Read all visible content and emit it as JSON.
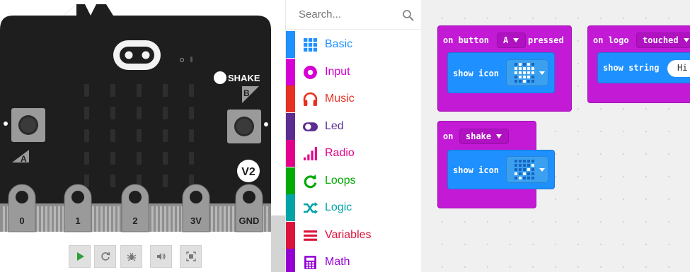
{
  "colors": {
    "board": "#1e1e1e",
    "pad": "#9a9a9a",
    "led_off": "#2e2e2e",
    "toolbox_border": "#e6e6e6",
    "event_block": "#c31ad6",
    "basic_block": "#1e90ff",
    "workspace": "#f0f0f0"
  },
  "simulator": {
    "shake_label": "SHAKE",
    "button_a": "A",
    "button_b": "B",
    "version_badge": "V2",
    "pins": [
      "0",
      "1",
      "2",
      "3V",
      "GND"
    ],
    "controls": [
      {
        "name": "play-icon"
      },
      {
        "name": "restart-icon"
      },
      {
        "name": "debug-icon"
      },
      {
        "name": "mute-icon"
      },
      {
        "name": "fullscreen-icon"
      }
    ]
  },
  "toolbox": {
    "search_placeholder": "Search...",
    "categories": [
      {
        "label": "Basic",
        "color": "#1e90ff",
        "icon": "grid-icon"
      },
      {
        "label": "Input",
        "color": "#d400d4",
        "icon": "target-icon"
      },
      {
        "label": "Music",
        "color": "#e63022",
        "icon": "headphones-icon"
      },
      {
        "label": "Led",
        "color": "#5c2d91",
        "icon": "toggle-icon"
      },
      {
        "label": "Radio",
        "color": "#e3008c",
        "icon": "signal-bars-icon"
      },
      {
        "label": "Loops",
        "color": "#00aa00",
        "icon": "loop-arrow-icon"
      },
      {
        "label": "Logic",
        "color": "#00a4a6",
        "icon": "shuffle-icon"
      },
      {
        "label": "Variables",
        "color": "#dc143c",
        "icon": "list-icon"
      },
      {
        "label": "Math",
        "color": "#9400d3",
        "icon": "calculator-icon"
      }
    ]
  },
  "workspace": {
    "block_button": {
      "prefix": "on button",
      "value": "A",
      "suffix": "pressed",
      "inner": "show icon"
    },
    "block_logo": {
      "prefix": "on logo",
      "value": "touched",
      "inner": "show string",
      "string_value": "Hi"
    },
    "block_shake": {
      "prefix": "on",
      "value": "shake",
      "inner": "show icon"
    }
  }
}
